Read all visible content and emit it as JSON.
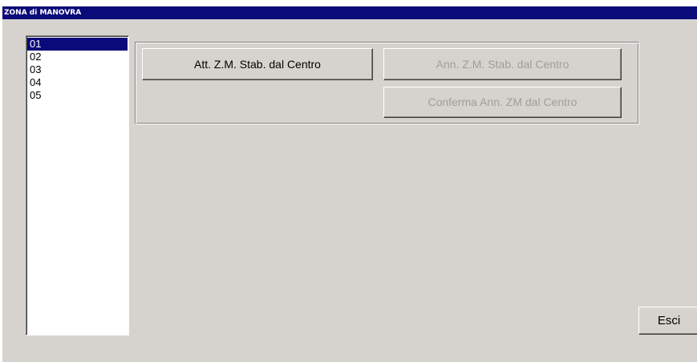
{
  "window": {
    "title": "ZONA di MANOVRA"
  },
  "zone_list": {
    "items": [
      "01",
      "02",
      "03",
      "04",
      "05"
    ],
    "selected": "01"
  },
  "actions": {
    "activate_label": "Att. Z.M. Stab. dal Centro",
    "annul_label": "Ann. Z.M. Stab. dal Centro",
    "confirm_annul_label": "Conferma Ann. ZM dal Centro",
    "annul_enabled": false,
    "confirm_annul_enabled": false
  },
  "footer": {
    "exit_label": "Esci"
  },
  "colors": {
    "titlebar": "#0a0a78",
    "selection": "#0a0a78",
    "face": "#d6d3ce",
    "disabled_text": "#a09e99"
  }
}
